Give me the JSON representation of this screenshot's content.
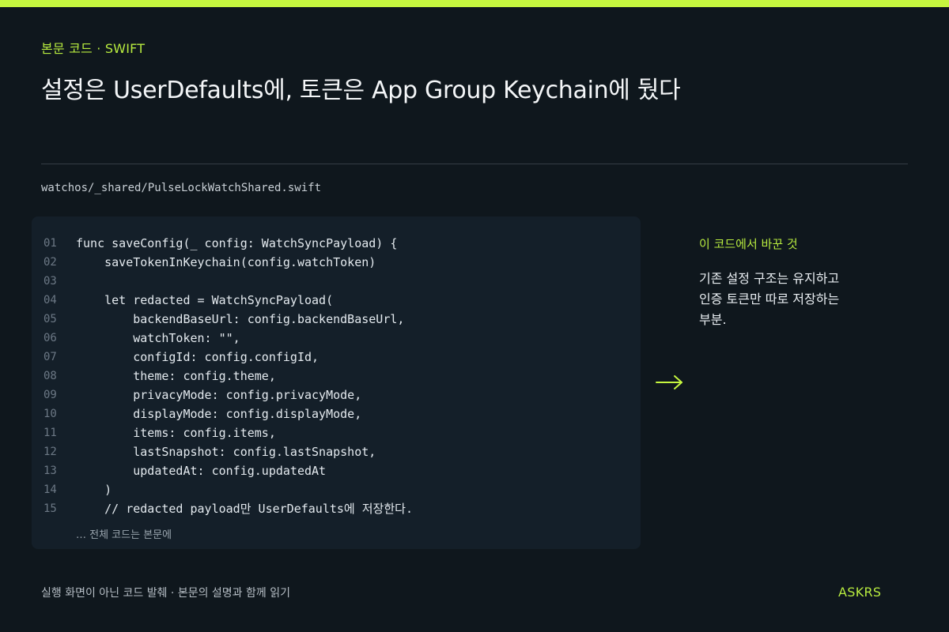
{
  "header": {
    "kicker": "본문 코드 · SWIFT",
    "title": "설정은 UserDefaults에, 토큰은 App Group Keychain에 뒀다"
  },
  "file": {
    "path": "watchos/_shared/PulseLockWatchShared.swift"
  },
  "code": {
    "lines": [
      {
        "no": "01",
        "text": "func saveConfig(_ config: WatchSyncPayload) {"
      },
      {
        "no": "02",
        "text": "    saveTokenInKeychain(config.watchToken)"
      },
      {
        "no": "03",
        "text": ""
      },
      {
        "no": "04",
        "text": "    let redacted = WatchSyncPayload("
      },
      {
        "no": "05",
        "text": "        backendBaseUrl: config.backendBaseUrl,"
      },
      {
        "no": "06",
        "text": "        watchToken: \"\","
      },
      {
        "no": "07",
        "text": "        configId: config.configId,"
      },
      {
        "no": "08",
        "text": "        theme: config.theme,"
      },
      {
        "no": "09",
        "text": "        privacyMode: config.privacyMode,"
      },
      {
        "no": "10",
        "text": "        displayMode: config.displayMode,"
      },
      {
        "no": "11",
        "text": "        items: config.items,"
      },
      {
        "no": "12",
        "text": "        lastSnapshot: config.lastSnapshot,"
      },
      {
        "no": "13",
        "text": "        updatedAt: config.updatedAt"
      },
      {
        "no": "14",
        "text": "    )"
      },
      {
        "no": "15",
        "text": "    // redacted payload만 UserDefaults에 저장한다."
      }
    ],
    "more_note": "… 전체 코드는 본문에"
  },
  "side": {
    "label": "이 코드에서 바꾼 것",
    "desc_lines": [
      "기존 설정 구조는 유지하고",
      "인증 토큰만 따로 저장하는",
      "부분."
    ],
    "arrow_icon": "arrow-right-icon"
  },
  "footer": {
    "note": "실행 화면이 아닌 코드 발췌 · 본문의 설명과 함께 읽기",
    "brand": "ASKRS"
  },
  "colors": {
    "accent": "#c6f73f",
    "background": "#0f171d",
    "panel": "#141f29"
  }
}
